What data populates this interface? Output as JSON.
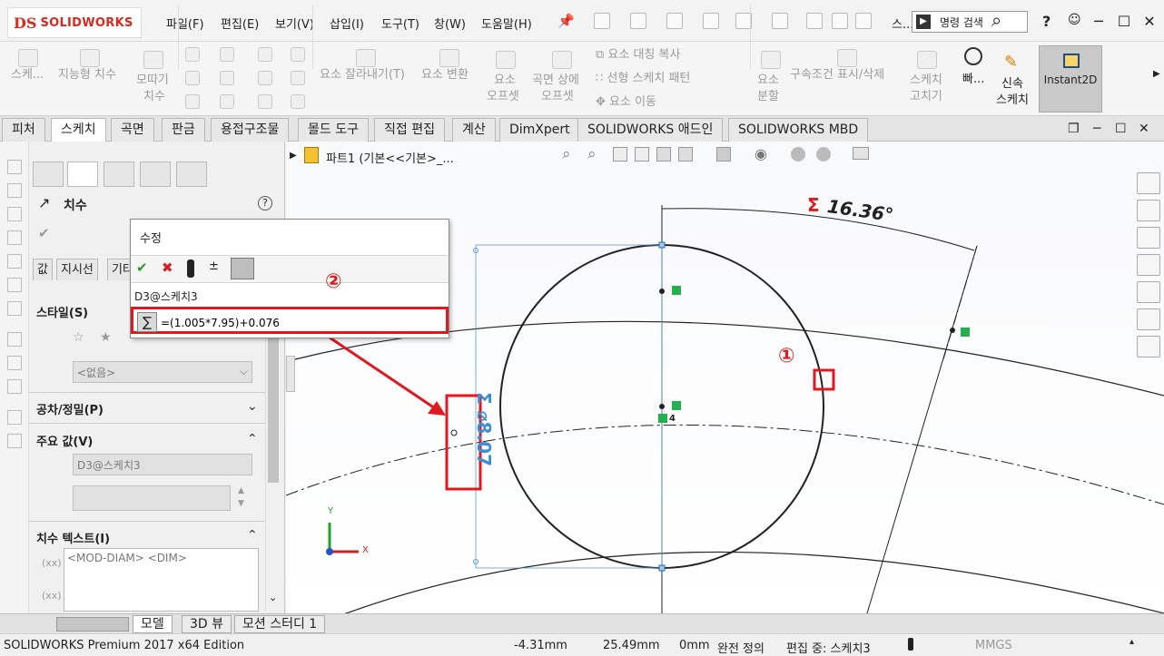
{
  "app": {
    "logo_mark": "DS",
    "logo_text": "SOLIDWORKS"
  },
  "menu": [
    "파일(F)",
    "편집(E)",
    "보기(V)",
    "삽입(I)",
    "도구(T)",
    "창(W)",
    "도움말(H)"
  ],
  "search": {
    "placeholder": "명령 검색",
    "help": "?",
    "user_icon": "person-icon"
  },
  "ribbon": {
    "smart_dim_1": "스케...",
    "smart_dim": "지능형 치수",
    "fillet_1": "모따기",
    "fillet_2": "치수",
    "trim": "요소 잘라내기(T)",
    "convert": "요소 변환",
    "offset_1": "요소",
    "offset_2": "오프셋",
    "surface_offset_1": "곡면 상에",
    "surface_offset_2": "오프셋",
    "mirror": "요소 대칭 복사",
    "linear_pattern": "선형 스케치 패턴",
    "move": "요소 이동",
    "split_1": "요소",
    "split_2": "분할",
    "relations": "구속조건 표시/삭제",
    "repair_1": "스케치",
    "repair_2": "고치기",
    "quick_snaps": "빠...",
    "rapid_1": "신속",
    "rapid_2": "스케치",
    "instant2d": "Instant2D"
  },
  "tabs": [
    "피처",
    "스케치",
    "곡면",
    "판금",
    "용접구조물",
    "몰드 도구",
    "직접 편집",
    "계산",
    "DimXpert",
    "SOLIDWORKS 애드인",
    "SOLIDWORKS MBD"
  ],
  "active_tab": "스케치",
  "tree": {
    "part": "파트1  (기본<<기본>_..."
  },
  "property_manager": {
    "title": "치수",
    "help": "?",
    "subtabs": [
      "값",
      "지시선",
      "기타"
    ],
    "style_label": "스타일(S)",
    "style_value": "<없음>",
    "tolerance_label": "공차/정밀(P)",
    "primary_label": "주요 값(V)",
    "primary_value": "D3@스케치3",
    "dimtext_label": "치수 텍스트(I)",
    "dimtext_value": "<MOD-DIAM> <DIM>"
  },
  "modify_dialog": {
    "title": "수정",
    "dim_name": "D3@스케치3",
    "expression": "=(1.005*7.95)+0.076",
    "sigma": "∑"
  },
  "annotations": {
    "callout_1": "①",
    "callout_2": "②"
  },
  "sketch": {
    "angle_dim": "16.36°",
    "diameter_dim": "⌀8.07",
    "sigma": "Σ",
    "point_label": "4",
    "axis_x": "X",
    "axis_y": "Y"
  },
  "bottom_tabs": [
    "모델",
    "3D 뷰",
    "모션 스터디 1"
  ],
  "status": {
    "edition": "SOLIDWORKS Premium 2017 x64 Edition",
    "x": "-4.31mm",
    "y": "25.49mm",
    "z": "0mm",
    "state": "완전 정의",
    "editing": "편집 중: 스케치3",
    "units": "MMGS"
  },
  "colors": {
    "accent_red": "#e2181f",
    "brand_red": "#da291c",
    "dim_blue": "#3a8fd6",
    "point_green": "#22b14c"
  }
}
